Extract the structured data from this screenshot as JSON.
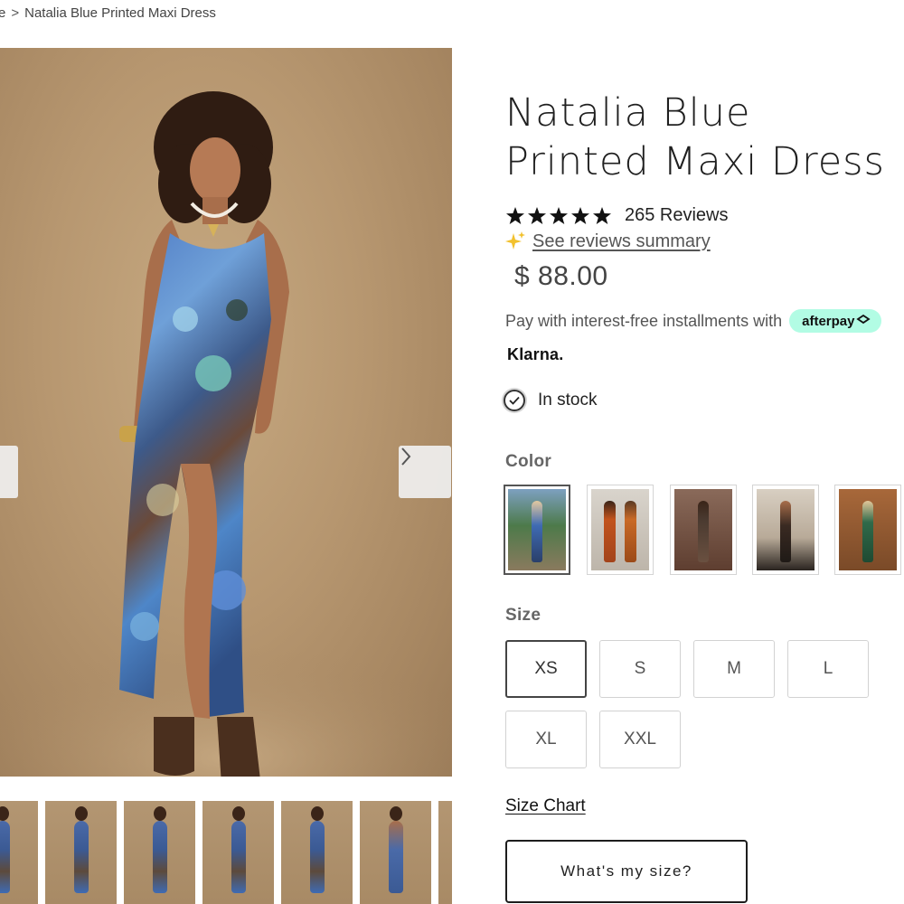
{
  "breadcrumb": {
    "prev_fragment": "e",
    "separator": ">",
    "current": "Natalia Blue Printed Maxi Dress"
  },
  "gallery": {
    "prev_icon": "chevron-left-icon",
    "next_icon": "chevron-right-icon",
    "thumbnail_count": 7
  },
  "product": {
    "title": "Natalia Blue Printed Maxi Dress",
    "rating": {
      "stars": 5,
      "reviews_label": "265 Reviews",
      "summary_link": "See reviews summary",
      "summary_icon": "sparkle-icon"
    },
    "price": "$ 88.00",
    "installments_text": "Pay with interest-free installments with",
    "afterpay_label": "afterpay",
    "klarna_label": "Klarna.",
    "stock": {
      "label": "In stock",
      "icon": "check-circle-icon"
    }
  },
  "color": {
    "label": "Color",
    "swatch_count": 5,
    "selected_index": 0
  },
  "size": {
    "label": "Size",
    "options": [
      "XS",
      "S",
      "M",
      "L",
      "XL",
      "XXL"
    ],
    "selected": "XS",
    "chart_link": "Size Chart",
    "fit_button": "What's my size?"
  },
  "colors": {
    "afterpay_mint": "#b2fce4",
    "star": "#111111",
    "sparkle": "#f2c12e"
  }
}
